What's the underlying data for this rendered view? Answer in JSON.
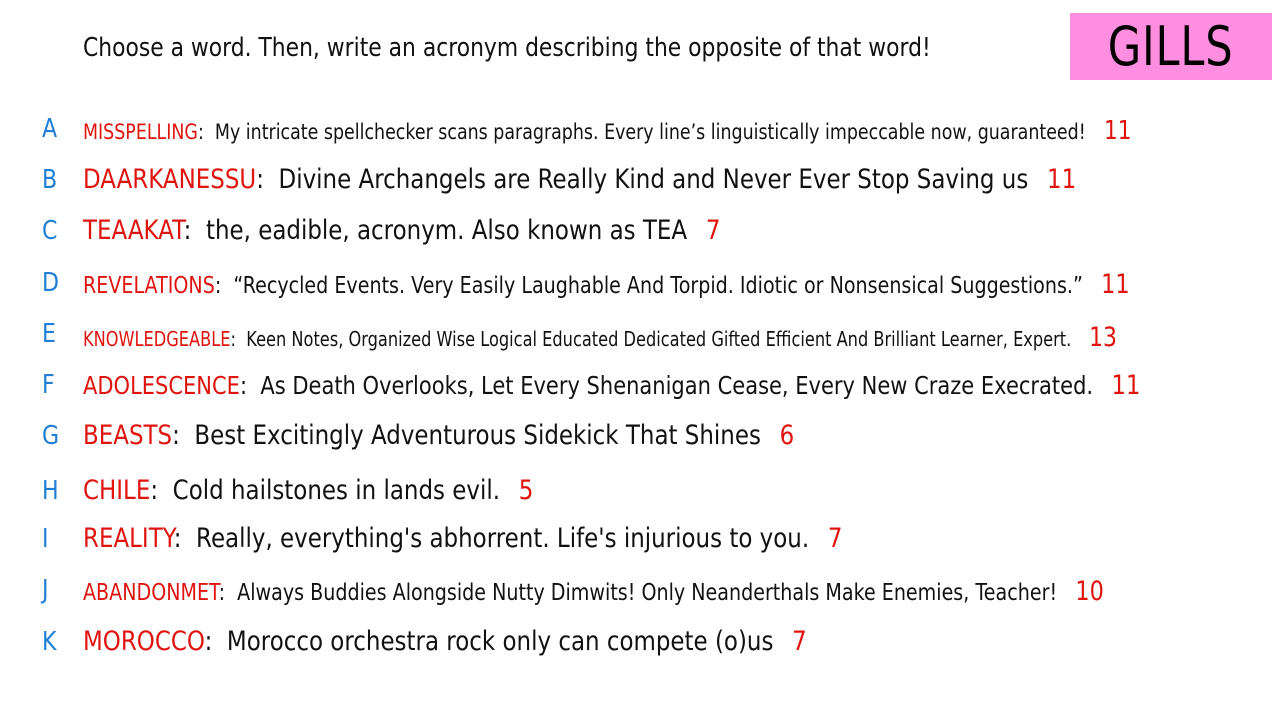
{
  "prompt": "Choose a word. Then, write an acronym describing the opposite of that word!",
  "team": "GILLS",
  "entries": [
    {
      "letter": "A",
      "word": "MISSPELLING",
      "phrase": "My intricate spellchecker scans paragraphs. Every line’s linguistically impeccable now, guaranteed!",
      "score": "11"
    },
    {
      "letter": "B",
      "word": "DAARKANESSU",
      "phrase": "Divine Archangels are Really Kind and Never Ever Stop Saving us",
      "score": "11"
    },
    {
      "letter": "C",
      "word": "TEAAKAT",
      "phrase": "the, eadible, acronym. Also known as TEA",
      "score": "7"
    },
    {
      "letter": "D",
      "word": "REVELATIONS",
      "phrase": "“Recycled Events. Very Easily Laughable And Torpid. Idiotic or Nonsensical Suggestions.”",
      "score": "11"
    },
    {
      "letter": "E",
      "word": "KNOWLEDGEABLE",
      "phrase": "Keen Notes, Organized Wise Logical Educated Dedicated Gifted Efficient And Brilliant Learner, Expert.",
      "score": "13"
    },
    {
      "letter": "F",
      "word": "ADOLESCENCE",
      "phrase": "As Death Overlooks, Let Every Shenanigan Cease, Every New Craze Execrated.",
      "score": "11"
    },
    {
      "letter": "G",
      "word": "BEASTS",
      "phrase": "Best Excitingly Adventurous Sidekick That Shines",
      "score": "6"
    },
    {
      "letter": "H",
      "word": "CHILE",
      "phrase": "Cold hailstones in lands evil.",
      "score": "5"
    },
    {
      "letter": "I",
      "word": "REALITY",
      "phrase": "Really, everything's abhorrent. Life's injurious to you.",
      "score": "7"
    },
    {
      "letter": "J",
      "word": "ABANDONMET",
      "phrase": "Always Buddies Alongside Nutty Dimwits! Only Neanderthals Make Enemies, Teacher!",
      "score": "10"
    },
    {
      "letter": "K",
      "word": "MOROCCO",
      "phrase": "Morocco orchestra rock only can compete (o)us",
      "score": "7"
    }
  ]
}
